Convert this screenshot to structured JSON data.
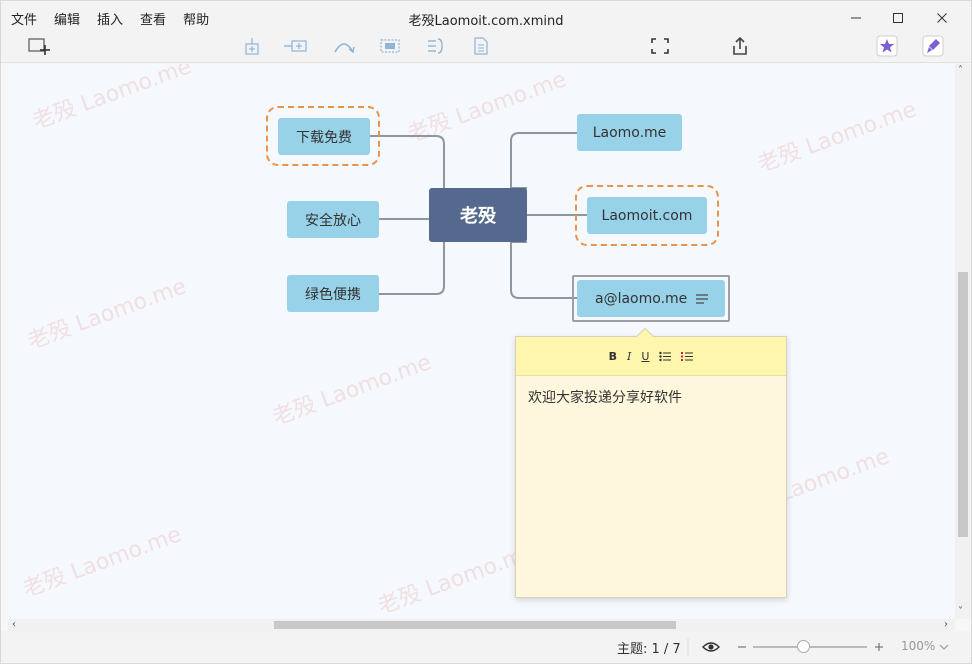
{
  "menu": [
    "文件",
    "编辑",
    "插入",
    "查看",
    "帮助"
  ],
  "window": {
    "title": "老殁Laomoit.com.xmind"
  },
  "mindmap": {
    "central": "老殁",
    "left": [
      "下载免费",
      "安全放心",
      "绿色便携"
    ],
    "right": [
      "Laomo.me",
      "Laomoit.com",
      "a@laomo.me"
    ]
  },
  "note": {
    "toolbar": [
      "B",
      "I",
      "U"
    ],
    "text": "欢迎大家投递分享好软件"
  },
  "watermark": "老殁 Laomo.me",
  "status": {
    "topic_count": "主题: 1 / 7",
    "zoom": "100%",
    "zoom_level": 1.0
  },
  "colors": {
    "node_fill": "#97d2e8",
    "central_fill": "#55698f",
    "dash_outline": "#e8934c",
    "note_toolbar": "#fff6ad",
    "note_body": "#fff7dd",
    "canvas": "#f5f9fd"
  }
}
